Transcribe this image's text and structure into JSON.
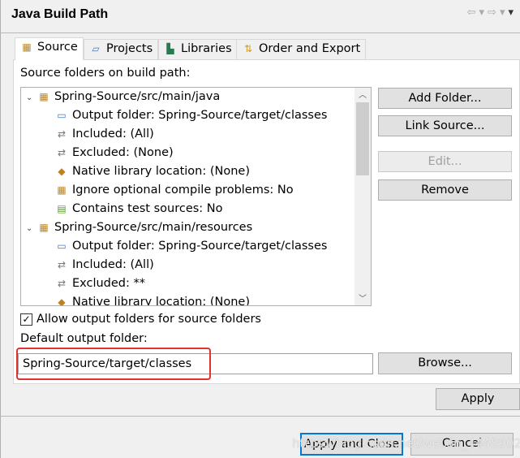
{
  "title": "Java Build Path",
  "tabs": [
    {
      "label": "Source",
      "icon": "source-folder-icon"
    },
    {
      "label": "Projects",
      "icon": "project-folder-icon"
    },
    {
      "label": "Libraries",
      "icon": "libraries-icon"
    },
    {
      "label": "Order and Export",
      "icon": "order-export-icon"
    }
  ],
  "active_tab": "Source",
  "source_label": "Source folders on build path:",
  "tree": [
    {
      "level": 0,
      "text": "Spring-Source/src/main/java",
      "expanded": true
    },
    {
      "level": 1,
      "text": "Output folder: Spring-Source/target/classes"
    },
    {
      "level": 1,
      "text": "Included: (All)"
    },
    {
      "level": 1,
      "text": "Excluded: (None)"
    },
    {
      "level": 1,
      "text": "Native library location: (None)"
    },
    {
      "level": 1,
      "text": "Ignore optional compile problems: No"
    },
    {
      "level": 1,
      "text": "Contains test sources: No"
    },
    {
      "level": 0,
      "text": "Spring-Source/src/main/resources",
      "expanded": true
    },
    {
      "level": 1,
      "text": "Output folder: Spring-Source/target/classes"
    },
    {
      "level": 1,
      "text": "Included: (All)"
    },
    {
      "level": 1,
      "text": "Excluded: **"
    },
    {
      "level": 1,
      "text": "Native library location: (None)"
    }
  ],
  "buttons": {
    "add_folder": "Add Folder...",
    "link_source": "Link Source...",
    "edit": "Edit...",
    "remove": "Remove",
    "browse": "Browse...",
    "apply": "Apply",
    "apply_close": "Apply and Close",
    "cancel": "Cancel"
  },
  "allow_output_label": "Allow output folders for source folders",
  "allow_output_checked": true,
  "default_output_label": "Default output folder:",
  "default_output_value": "Spring-Source/target/classes",
  "watermark": "https://blog.csdn.net/weixin_44489022"
}
